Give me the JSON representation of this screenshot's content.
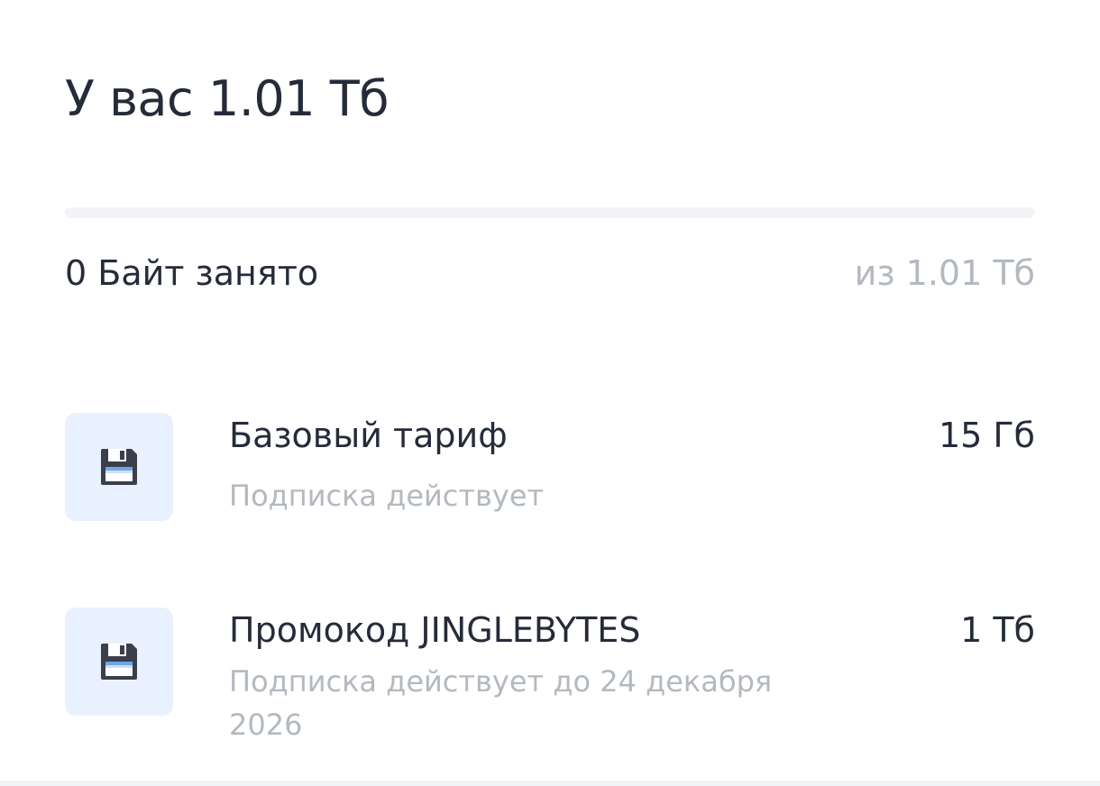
{
  "header": {
    "title": "У вас 1.01 Тб"
  },
  "usage": {
    "used_label": "0 Байт занято",
    "total_label": "из 1.01 Тб",
    "fill_fraction": 0,
    "fill_color": "#2f6bff",
    "track_color": "#f2f4f7"
  },
  "plans": [
    {
      "icon": "floppy-disk-icon",
      "name": "Базовый тариф",
      "status": "Подписка действует",
      "size": "15 Гб"
    },
    {
      "icon": "floppy-disk-icon",
      "name": "Промокод JINGLEBYTES",
      "status": "Подписка действует до 24 декабря 2026",
      "size": "1 Тб"
    }
  ],
  "colors": {
    "primary_text": "#262b3a",
    "secondary_text": "#b3b9bf",
    "icon_tile_bg": "#eaf1fe"
  }
}
